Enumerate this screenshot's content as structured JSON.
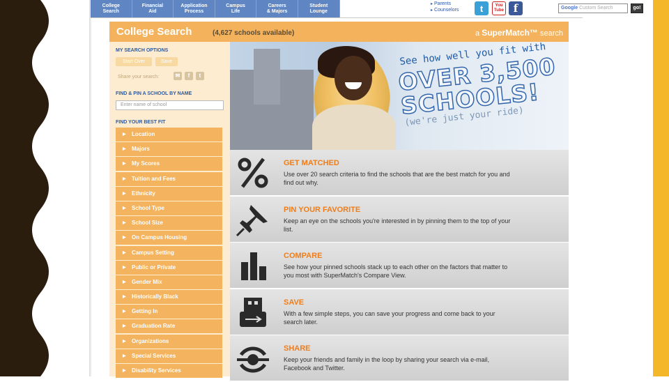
{
  "topnav": {
    "tabs": [
      "College\nSearch",
      "Financial\nAid",
      "Application\nProcess",
      "Campus\nLife",
      "Careers\n& Majors",
      "Student\nLounge"
    ],
    "audience_links": [
      "Parents",
      "Counselors"
    ],
    "social": {
      "twitter": "t",
      "youtube_top": "You",
      "youtube_bottom": "Tube",
      "facebook": "f"
    },
    "search_brand": "Google",
    "search_placeholder": "Custom Search",
    "go_label": "go!"
  },
  "header": {
    "title": "College Search",
    "count": "(4,627 schools available)",
    "right_prefix": "a",
    "right_brand": "SuperMatch™",
    "right_suffix": "search"
  },
  "sidebar": {
    "search_options_heading": "MY SEARCH OPTIONS",
    "start_over_label": "Start Over",
    "save_label": "Save",
    "share_label": "Share your search:",
    "find_pin_heading": "FIND & PIN A SCHOOL BY NAME",
    "name_placeholder": "Enter name of school",
    "best_fit_heading": "FIND YOUR BEST FIT",
    "filters": [
      "Location",
      "Majors",
      "My Scores",
      "Tuition and Fees",
      "Ethnicity",
      "School Type",
      "School Size",
      "On Campus Housing",
      "Campus Setting",
      "Public or Private",
      "Gender Mix",
      "Historically Black",
      "Getting In",
      "Graduation Rate",
      "Organizations",
      "Special Services",
      "Disability Services"
    ]
  },
  "hero": {
    "line1": "See how well you fit with",
    "line2a": "OVER 3,500",
    "line2b": "SCHOOLS!",
    "line3": "(we're just your ride)"
  },
  "features": [
    {
      "icon": "percent-icon",
      "title": "GET MATCHED",
      "desc": "Use over 20 search criteria to find the schools that are the best match for you and find out why."
    },
    {
      "icon": "pushpin-icon",
      "title": "PIN YOUR FAVORITE",
      "desc": "Keep an eye on the schools you're interested in by pinning them to the top of your list."
    },
    {
      "icon": "bar-chart-icon",
      "title": "COMPARE",
      "desc": "See how your pinned schools stack up to each other on the factors that matter to you most with SuperMatch's Compare View."
    },
    {
      "icon": "usb-drive-icon",
      "title": "SAVE",
      "desc": "With a few simple steps, you can save your progress and come back to your search later."
    },
    {
      "icon": "share-icon",
      "title": "SHARE",
      "desc": "Keep your friends and family in the loop by sharing your search via e-mail, Facebook and Twitter."
    }
  ],
  "colors": {
    "nav_blue": "#5f86c3",
    "orange": "#f4b25c",
    "accent_orange": "#ee7d1b",
    "slide_gold": "#f5b72a"
  }
}
